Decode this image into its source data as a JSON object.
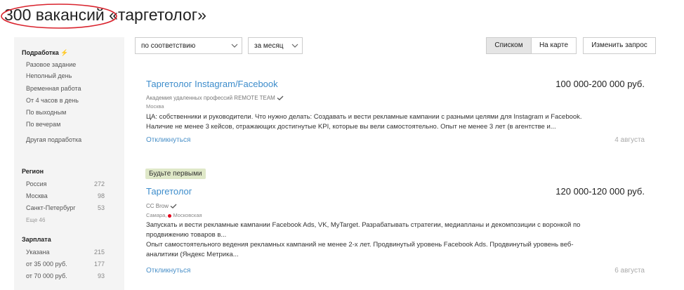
{
  "header": {
    "title": "300 вакансий «таргетолог»"
  },
  "sidebar": {
    "sections": [
      {
        "heading": "Подработка",
        "items": [
          {
            "label": "Разовое задание"
          },
          {
            "label": "Неполный день"
          },
          {
            "label": "Временная работа"
          },
          {
            "label": "От 4 часов в день"
          },
          {
            "label": "По выходным"
          },
          {
            "label": "По вечерам"
          },
          {
            "label": "Другая подработка"
          }
        ]
      },
      {
        "heading": "Регион",
        "items": [
          {
            "label": "Россия",
            "count": "272"
          },
          {
            "label": "Москва",
            "count": "98"
          },
          {
            "label": "Санкт-Петербург",
            "count": "53"
          },
          {
            "label": "Еще 46"
          }
        ]
      },
      {
        "heading": "Зарплата",
        "items": [
          {
            "label": "Указана",
            "count": "215"
          },
          {
            "label": "от 35 000 руб.",
            "count": "177"
          },
          {
            "label": "от 70 000 руб.",
            "count": "93"
          }
        ]
      }
    ]
  },
  "toolbar": {
    "sort_select": "по соответствию",
    "period_select": "за месяц",
    "view_list": "Списком",
    "view_map": "На карте",
    "change_query": "Изменить запрос"
  },
  "vacancies": [
    {
      "title": "Таргетолог Instagram/Facebook",
      "salary": "100 000-200 000 руб.",
      "company": "Академия удаленных профессий REMOTE TEAM",
      "city": "Москва",
      "desc1": "ЦА: собственники и руководители. Что нужно делать: Создавать и вести рекламные кампании с разными целями для Instagram и Facebook.",
      "desc2": "Наличие не менее 3 кейсов, отражающих достигнутые KPI, которые вы вели самостоятельно. Опыт не менее 3 лет (в агентстве и...",
      "apply": "Откликнуться",
      "date": "4 августа"
    },
    {
      "badge": "Будьте первыми",
      "title": "Таргетолог",
      "salary": "120 000-120 000 руб.",
      "company": "CC Brow",
      "city": "Самара,",
      "metro": "Московская",
      "desc1": "Запускать и вести рекламные кампании Facebook Ads, VK, MyTarget. Разрабатывать стратегии, медиапланы и декомпозиции с воронкой по",
      "desc2": "продвижению товаров в...",
      "desc3": "Опыт самостоятельного ведения рекламных кампаний не менее 2-х лет. Продвинутый уровень Facebook Ads. Продвинутый уровень веб-",
      "desc4": "аналитики (Яндекс Метрика...",
      "apply": "Откликнуться",
      "date": "6 августа"
    }
  ]
}
